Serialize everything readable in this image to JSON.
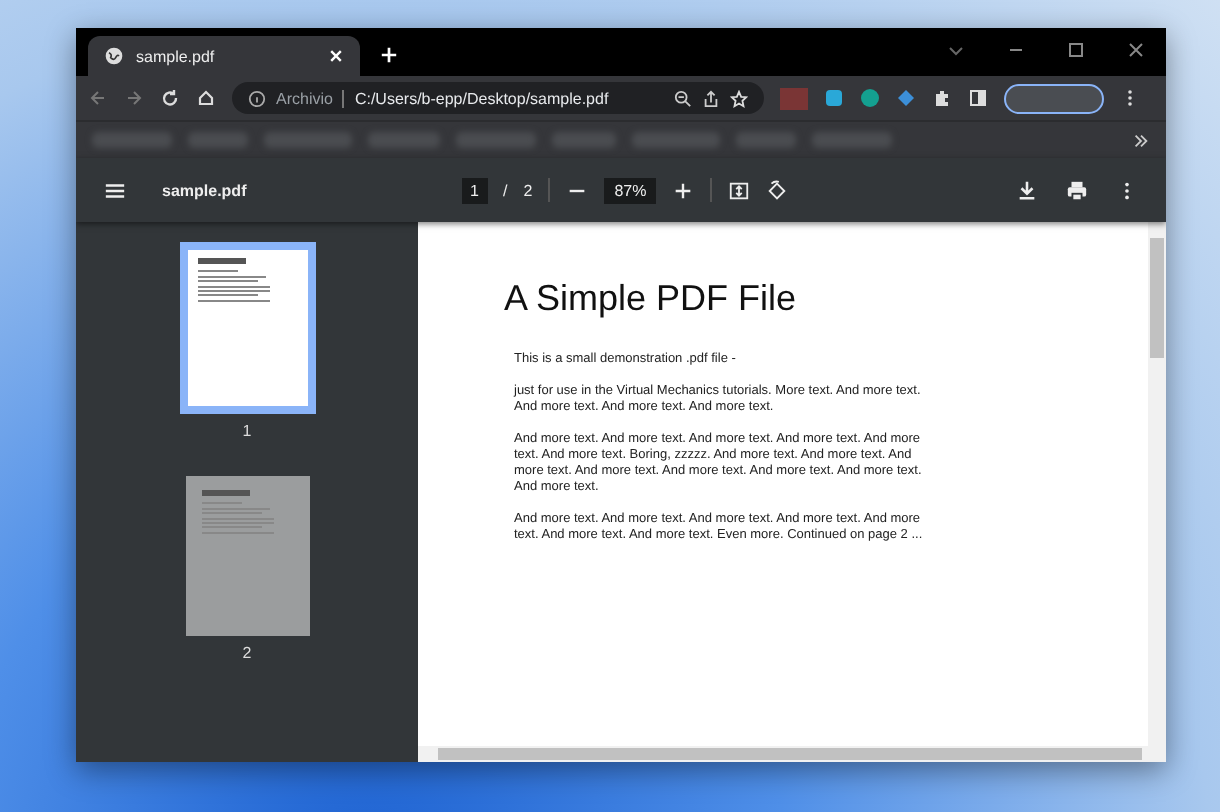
{
  "tabs": [
    {
      "title": "sample.pdf",
      "selected": true
    }
  ],
  "address_bar": {
    "scheme_label": "Archivio",
    "url": "C:/Users/b-epp/Desktop/sample.pdf"
  },
  "pdf_toolbar": {
    "file_name": "sample.pdf",
    "current_page": "1",
    "page_separator": "/",
    "page_count": "2",
    "zoom": "87%"
  },
  "thumbnails": [
    {
      "label": "1",
      "selected": true
    },
    {
      "label": "2",
      "selected": false
    }
  ],
  "document": {
    "title": "A Simple PDF File",
    "paragraphs": [
      "This is a small demonstration .pdf file -",
      "just for use in the Virtual Mechanics tutorials. More text. And more text. And more text. And more text. And more text.",
      "And more text. And more text. And more text. And more text. And more text. And more text. Boring, zzzzz. And more text. And more text. And more text. And more text. And more text. And more text. And more text. And more text.",
      "And more text. And more text. And more text. And more text. And more text. And more text. And more text. Even more. Continued on page 2 ..."
    ]
  }
}
